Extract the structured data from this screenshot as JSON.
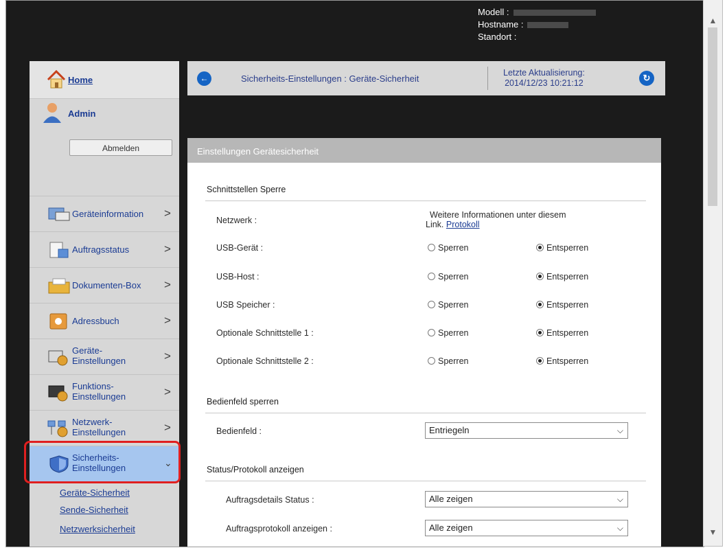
{
  "header": {
    "modell_label": "Modell :",
    "hostname_label": "Hostname :",
    "standort_label": "Standort :"
  },
  "sidebar": {
    "home": "Home",
    "admin": "Admin",
    "logout": "Abmelden",
    "items": [
      {
        "label": "Geräteinformation",
        "icon": "device-info-icon"
      },
      {
        "label": "Auftragsstatus",
        "icon": "job-status-icon"
      },
      {
        "label": "Dokumenten-Box",
        "icon": "document-box-icon"
      },
      {
        "label": "Adressbuch",
        "icon": "address-book-icon"
      },
      {
        "label": "Geräte-\nEinstellungen",
        "icon": "device-settings-icon"
      },
      {
        "label": "Funktions-\nEinstellungen",
        "icon": "function-settings-icon"
      },
      {
        "label": "Netzwerk-\nEinstellungen",
        "icon": "network-settings-icon"
      },
      {
        "label": "Sicherheits-\nEinstellungen",
        "icon": "security-shield-icon",
        "active": true
      }
    ],
    "sub_items": [
      "Geräte-Sicherheit",
      "Sende-Sicherheit",
      "Netzwerksicherheit"
    ]
  },
  "topbar": {
    "breadcrumb": "Sicherheits-Einstellungen : Geräte-Sicherheit",
    "last_update_label": "Letzte Aktualisierung:",
    "last_update_value": "2014/12/23 10:21:12"
  },
  "panel": {
    "title": "Einstellungen Gerätesicherheit",
    "interface_section": "Schnittstellen Sperre",
    "network_label": "Netzwerk :",
    "network_info": "Weitere Informationen unter diesem",
    "network_info_link_prefix": "Link.",
    "network_info_link": "Protokoll",
    "lock_label": "Sperren",
    "unlock_label": "Entsperren",
    "interfaces": [
      {
        "label": "USB-Gerät :",
        "value": "Entsperren"
      },
      {
        "label": "USB-Host :",
        "value": "Entsperren"
      },
      {
        "label": "USB Speicher :",
        "value": "Entsperren"
      },
      {
        "label": "Optionale Schnittstelle 1 :",
        "value": "Entsperren"
      },
      {
        "label": "Optionale Schnittstelle 2 :",
        "value": "Entsperren"
      }
    ],
    "panel_section": "Bedienfeld sperren",
    "panel_label": "Bedienfeld :",
    "panel_value": "Entriegeln",
    "status_section": "Status/Protokoll anzeigen",
    "job_details_label": "Auftragsdetails Status :",
    "job_details_value": "Alle zeigen",
    "job_log_label": "Auftragsprotokoll anzeigen :",
    "job_log_value": "Alle zeigen"
  },
  "colors": {
    "accent_blue": "#1564c4",
    "link_blue": "#1a3b93",
    "highlight_red": "#e01f1f",
    "active_item_bg": "#a6c6ef"
  }
}
